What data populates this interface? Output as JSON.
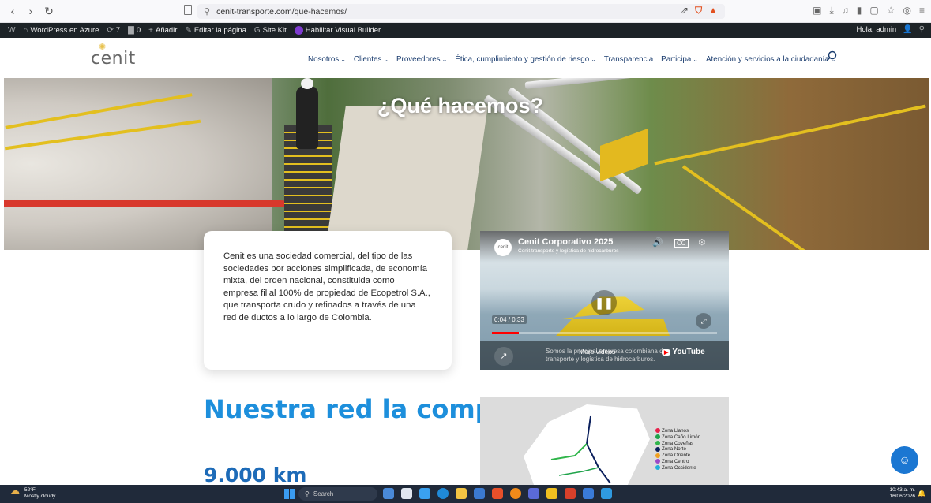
{
  "browser": {
    "url": "cenit-transporte.com/que-hacemos/",
    "back": "‹",
    "forward": "›",
    "reload": "↻"
  },
  "wpbar": {
    "wp_logo": "W",
    "site": "WordPress en Azure",
    "updates": "7",
    "comments": "0",
    "add": "Añadir",
    "edit": "Editar la página",
    "sitekit": "Site Kit",
    "visual": "Habilitar Visual Builder",
    "greeting": "Hola, admin"
  },
  "site": {
    "logo": "cenit",
    "nav": [
      {
        "label": "Nosotros",
        "caret": "⌄"
      },
      {
        "label": "Clientes",
        "caret": "⌄"
      },
      {
        "label": "Proveedores",
        "caret": "⌄"
      },
      {
        "label": "Ética, cumplimiento y gestión de riesgo",
        "caret": "⌄"
      },
      {
        "label": "Transparencia",
        "caret": ""
      },
      {
        "label": "Participa",
        "caret": "⌄"
      },
      {
        "label": "Atención y servicios a la ciudadanía",
        "caret": "⌄"
      }
    ]
  },
  "hero": {
    "title": "¿Qué hacemos?"
  },
  "card": {
    "text": "Cenit es una sociedad comercial, del tipo de las sociedades por acciones simplificada, de economía mixta, del orden nacional, constituida como empresa filial 100% de propiedad de Ecopetrol S.A., que transporta crudo y refinados a través de una red de ductos a lo largo de Colombia."
  },
  "video": {
    "title": "Cenit Corporativo 2025",
    "subtitle": "Cenit transporte y logística de hidrocarburos",
    "time": "0:04 / 0:33",
    "progress": 0.12,
    "more": "More videos",
    "caption": "Somos la principal empresa colombiana de transporte y logística de hidrocarburos.",
    "youtube": "YouTube",
    "channel_logo": "cenit"
  },
  "section": {
    "title": "Nuestra red la componen",
    "stat": "9.000 km"
  },
  "map": {
    "legend": [
      {
        "label": "Zona Llanos",
        "color": "#e8204a"
      },
      {
        "label": "Zona Caño Limón",
        "color": "#1fa34a"
      },
      {
        "label": "Zona Coveñas",
        "color": "#2fb54a"
      },
      {
        "label": "Zona Norte",
        "color": "#0a1f5c"
      },
      {
        "label": "Zona Oriente",
        "color": "#f0a020"
      },
      {
        "label": "Zona Centro",
        "color": "#9b4ac8"
      },
      {
        "label": "Zona Occidente",
        "color": "#20b0d8"
      }
    ]
  },
  "taskbar": {
    "temp": "52°F",
    "weather": "Mostly cloudy",
    "search": "Search",
    "time": "10:43 a. m.",
    "date": "16/06/2026"
  }
}
